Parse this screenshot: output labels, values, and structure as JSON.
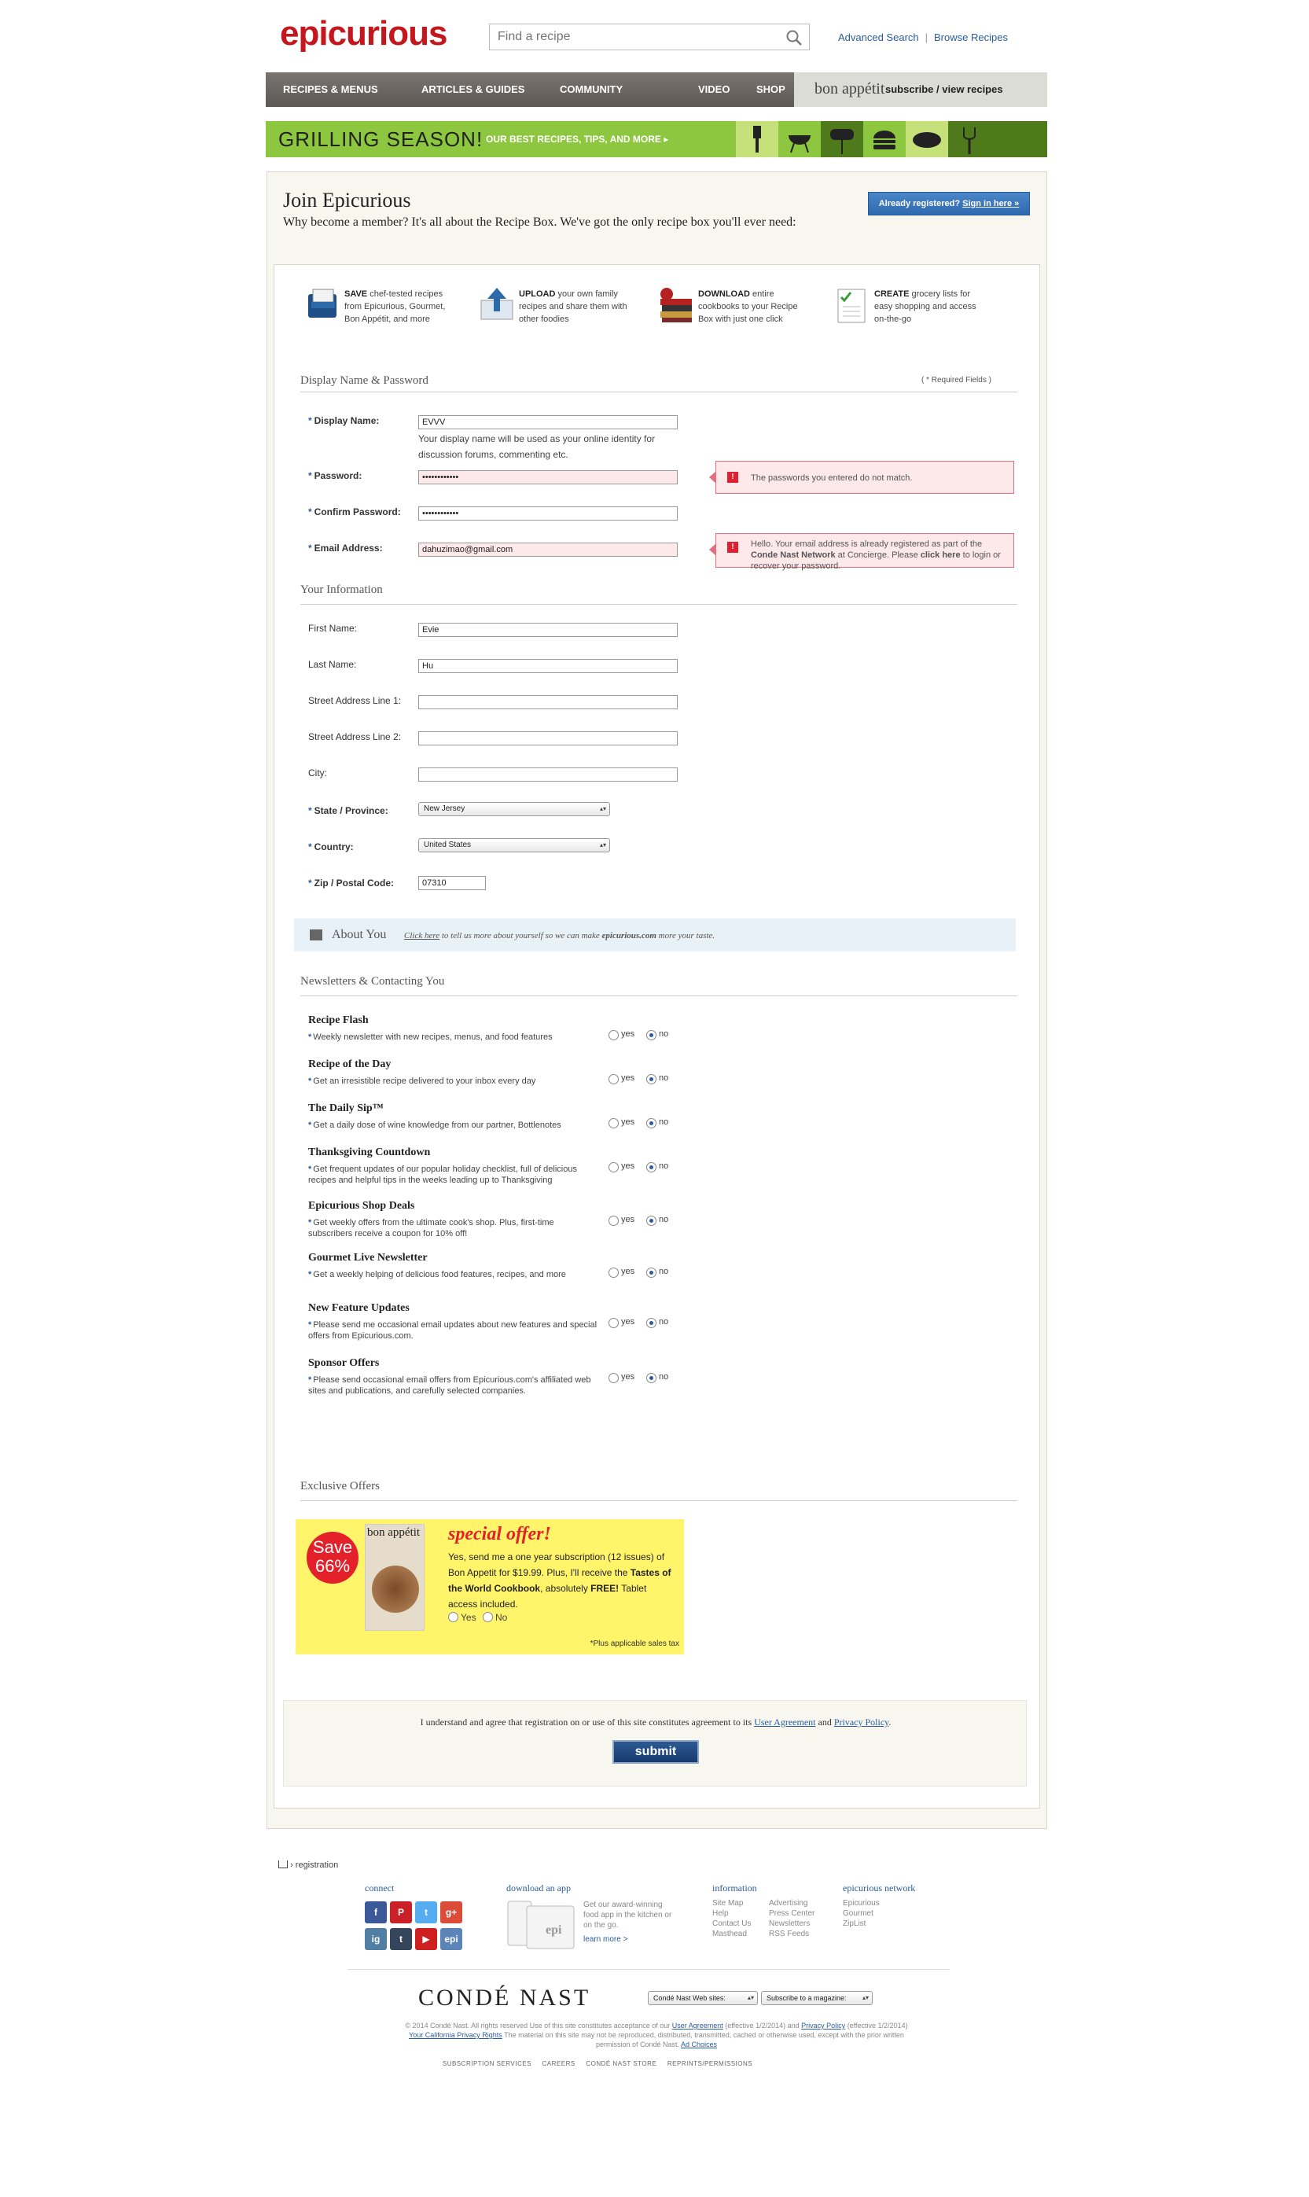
{
  "header": {
    "logo": "epicurious",
    "search_placeholder": "Find a recipe",
    "advanced_search": "Advanced Search",
    "separator": "|",
    "browse_recipes": "Browse Recipes"
  },
  "nav": {
    "items": [
      "RECIPES & MENUS",
      "ARTICLES & GUIDES",
      "COMMUNITY",
      "VIDEO",
      "SHOP"
    ],
    "bon_appetit": "bon appétit",
    "subscribe": "subscribe / view recipes"
  },
  "banner": {
    "title": "GRILLING SEASON!",
    "subtitle": "OUR BEST RECIPES, TIPS, AND MORE ▸"
  },
  "join": {
    "title": "Join Epicurious",
    "subtitle": "Why become a member? It's all about the Recipe Box. We've got the only recipe box you'll ever need:",
    "signin_prefix": "Already registered?",
    "signin_link": "Sign in here »"
  },
  "benefits": [
    {
      "bold": "SAVE",
      "text": " chef-tested recipes from Epicurious, Gourmet, Bon Appétit, and more"
    },
    {
      "bold": "UPLOAD",
      "text": " your own family recipes and share them with other foodies"
    },
    {
      "bold": "DOWNLOAD",
      "text": " entire cookbooks to your Recipe Box with just one click"
    },
    {
      "bold": "CREATE",
      "text": " grocery lists for easy shopping and access on-the-go"
    }
  ],
  "account": {
    "section_title": "Display Name & Password",
    "required_note": "( * Required Fields )",
    "display_name_label": "Display Name:",
    "display_name_value": "EVVV",
    "display_name_help": "Your display name will be used as your online identity for discussion forums, commenting etc.",
    "password_label": "Password:",
    "password_value": "••••••••••••",
    "password_error": "The passwords you entered do not match.",
    "confirm_label": "Confirm Password:",
    "confirm_value": "••••••••••••",
    "email_label": "Email Address:",
    "email_value": "dahuzimao@gmail.com",
    "email_error_1": "Hello. Your email address is already registered as part of the ",
    "email_error_bold": "Conde Nast Network",
    "email_error_2": " at Concierge. Please ",
    "email_error_link": "click here",
    "email_error_3": " to login or recover your password."
  },
  "info": {
    "section_title": "Your Information",
    "first_name_label": "First Name:",
    "first_name_value": "Evie",
    "last_name_label": "Last Name:",
    "last_name_value": "Hu",
    "street1_label": "Street Address Line 1:",
    "street2_label": "Street Address Line 2:",
    "city_label": "City:",
    "state_label": "State / Province:",
    "state_value": "New Jersey",
    "country_label": "Country:",
    "country_value": "United States",
    "zip_label": "Zip / Postal Code:",
    "zip_value": "07310"
  },
  "about": {
    "title": "About You",
    "link": "Click here",
    "text_1": " to tell us more about yourself so we can make ",
    "text_bold": "epicurious.com",
    "text_2": " more your taste."
  },
  "newsletters": {
    "section_title": "Newsletters & Contacting You",
    "yes": "yes",
    "no": "no",
    "items": [
      {
        "title": "Recipe Flash",
        "desc": "Weekly newsletter with new recipes, menus, and food features"
      },
      {
        "title": "Recipe of the Day",
        "desc": "Get an irresistible recipe delivered to your inbox every day"
      },
      {
        "title": "The Daily Sip™",
        "desc": "Get a daily dose of wine knowledge from our partner, Bottlenotes"
      },
      {
        "title": "Thanksgiving Countdown",
        "desc": "Get frequent updates of our popular holiday checklist, full of delicious recipes and helpful tips in the weeks leading up to Thanksgiving"
      },
      {
        "title": "Epicurious Shop Deals",
        "desc": "Get weekly offers from the ultimate cook's shop. Plus, first-time subscribers receive a coupon for 10% off!"
      },
      {
        "title": "Gourmet Live Newsletter",
        "desc": "Get a weekly helping of delicious food features, recipes, and more"
      },
      {
        "title": "New Feature Updates",
        "desc": "Please send me occasional email updates about new features and special offers from Epicurious.com."
      },
      {
        "title": "Sponsor Offers",
        "desc": "Please send occasional email offers from Epicurious.com's affiliated web sites and publications, and carefully selected companies."
      }
    ]
  },
  "offers": {
    "section_title": "Exclusive Offers",
    "save_1": "Save",
    "save_2": "66%",
    "mag_title": "bon appétit",
    "offer_title": "special offer!",
    "offer_text_1": "Yes, send me a one year subscription (12 issues) of Bon Appetit for $19.99. Plus, I'll receive the ",
    "offer_bold": "Tastes of the World Cookbook",
    "offer_text_2": ", absolutely ",
    "offer_free": "FREE!",
    "offer_text_3": " Tablet access included.",
    "yes": "Yes",
    "no": "No",
    "note": "*Plus applicable sales tax"
  },
  "agree": {
    "text_1": "I understand and agree that registration on or use of this site constitutes agreement to its ",
    "user_agreement": "User Agreement",
    "and": " and ",
    "privacy": "Privacy Policy",
    "period": ".",
    "submit": "submit"
  },
  "footer": {
    "crumb": "› registration",
    "connect": "connect",
    "social": [
      "f",
      "P",
      "t",
      "g+",
      "ig",
      "t",
      "▶",
      "epi"
    ],
    "download_app": "download an app",
    "app_text": "Get our award-winning food app in the kitchen or on the go.",
    "learn_more": "learn more >",
    "app_label": "epi",
    "information": "information",
    "info_col1": [
      "Site Map",
      "Help",
      "Contact Us",
      "Masthead"
    ],
    "info_col2": [
      "Advertising",
      "Press Center",
      "Newsletters",
      "RSS Feeds"
    ],
    "network": "epicurious network",
    "network_links": [
      "Epicurious",
      "Gourmet",
      "ZipList"
    ],
    "conde": "CONDÉ NAST",
    "conde_select": "Condé Nast Web sites:",
    "magazine_select": "Subscribe to a magazine:",
    "legal_1": "© 2014 Condé Nast. All rights reserved Use of this site constitutes acceptance of our ",
    "legal_ua": "User Agreement",
    "legal_2": " (effective 1/2/2014) and ",
    "legal_pp": "Privacy Policy",
    "legal_3": " (effective 1/2/2014) ",
    "legal_ca": "Your California Privacy Rights",
    "legal_4": " The material on this site may not be reproduced, distributed, transmitted, cached or otherwise used, except with the prior written permission of Condé Nast. ",
    "legal_ad": "Ad Choices",
    "bottom_links": "SUBSCRIPTION SERVICES     CAREERS     CONDÉ NAST STORE     REPRINTS/PERMISSIONS"
  }
}
